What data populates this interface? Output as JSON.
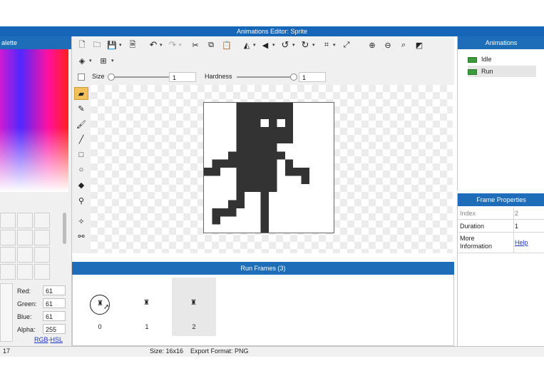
{
  "window": {
    "title": "Animations Editor: Sprite"
  },
  "palette": {
    "title": "alette",
    "red_label": "Red:",
    "red_value": "61",
    "green_label": "Green:",
    "green_value": "61",
    "blue_label": "Blue:",
    "blue_value": "61",
    "alpha_label": "Alpha:",
    "alpha_value": "255",
    "rgb_link": "RGB",
    "separator": "-",
    "hsl_link": "HSL"
  },
  "toolbar": {
    "size_label": "Size",
    "size_value": "1",
    "hardness_label": "Hardness",
    "hardness_value": "1"
  },
  "frames": {
    "title": "Run Frames (3)",
    "items": [
      {
        "label": "0"
      },
      {
        "label": "1"
      },
      {
        "label": "2"
      }
    ]
  },
  "animations": {
    "title": "Animations",
    "items": [
      {
        "label": "Idle"
      },
      {
        "label": "Run"
      }
    ]
  },
  "frame_properties": {
    "title": "Frame Properties",
    "index_label": "Index",
    "index_value": "2",
    "duration_label": "Duration",
    "duration_value": "1",
    "more_info_label": "More Information",
    "help_link": "Help"
  },
  "status": {
    "left": "17",
    "size": "Size: 16x16",
    "export_format": "Export Format: PNG"
  },
  "colors": {
    "accent": "#1e6db8",
    "sprite": "#333333",
    "anim_green": "#3c9a3c"
  }
}
